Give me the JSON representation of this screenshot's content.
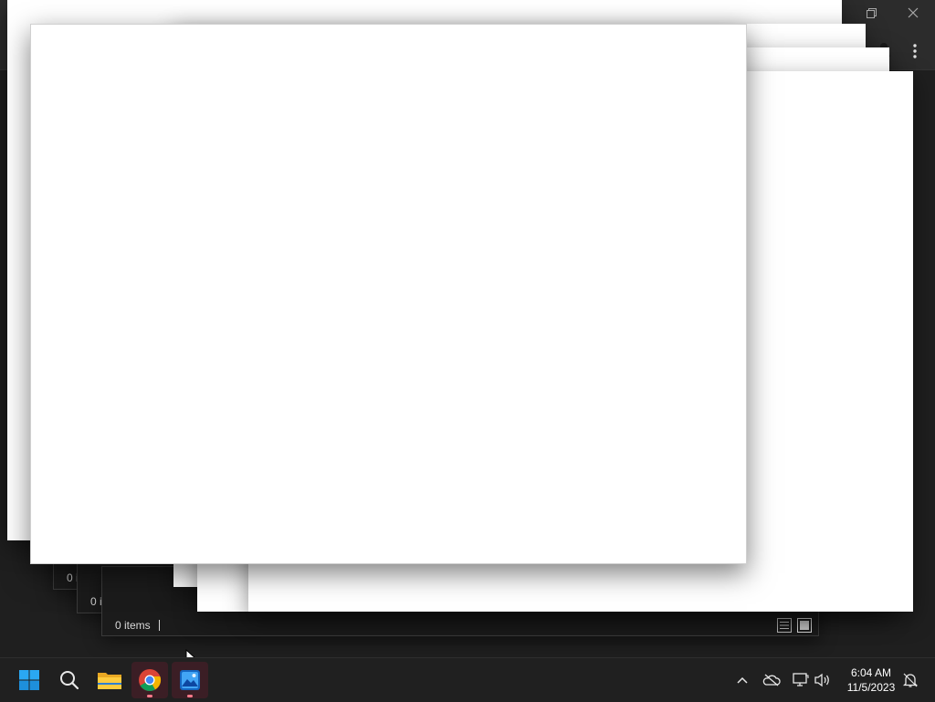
{
  "explorer": {
    "status_items_full": "0 items",
    "status_items_partial_1": "0 i",
    "status_items_partial_2": "0 i"
  },
  "taskbar": {
    "apps": [
      {
        "name": "Start",
        "icon": "windows-start-icon"
      },
      {
        "name": "Search",
        "icon": "search-icon"
      },
      {
        "name": "File Explorer",
        "icon": "folder-icon"
      },
      {
        "name": "Google Chrome",
        "icon": "chrome-icon",
        "active": true
      },
      {
        "name": "Photos",
        "icon": "photos-icon",
        "active": true
      }
    ],
    "tray": {
      "icons": [
        "chevron-up-icon",
        "onedrive-offline-icon",
        "network-icon",
        "volume-icon",
        "notification-icon"
      ]
    },
    "clock": {
      "time": "6:04 AM",
      "date": "11/5/2023"
    }
  },
  "colors": {
    "taskbar_bg": "#202020",
    "pane_bg": "#ffffff",
    "active_indicator": "#ff7a8a",
    "windows_blue": "#0a84d6"
  }
}
